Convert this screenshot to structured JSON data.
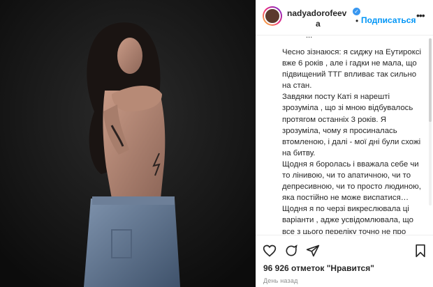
{
  "post": {
    "username_line1": "nadyadorofeev",
    "username_line2": "a",
    "dot": "•",
    "follow_label": "Подписаться",
    "more_label": "•••",
    "caption_cut": "...",
    "caption": "Чесно зізнаюся: я сиджу на Еутироксі вже 6 років , але і гадки не мала, що підвищений ТТГ впливає так сильно на стан.\nЗавдяки посту Каті я нарешті зрозуміла , що зі мною відбувалось протягом останніх 3 років. Я зрозуміла, чому я просиналась втомленою, і далі - мої дні були схожі на битву.\nЩодня я боролась і вважала себе чи то лінивою, чи то апатичною, чи то депресивною, чи то просто людиною, яка постійно не може виспатися…\nЩодня я по черзі викреслювала ці варіанти , адже усвідомлювала, що все з цього переліку точно не про мене .",
    "likes": "96 926 отметок \"Нравится\"",
    "time": "День назад"
  },
  "icons": {
    "like": "heart-icon",
    "comment": "comment-icon",
    "share": "send-icon",
    "save": "bookmark-icon",
    "verified": "verified-badge-icon"
  },
  "colors": {
    "accent": "#0095f6",
    "verified": "#3897f0",
    "text": "#262626",
    "muted": "#8e8e8e"
  }
}
